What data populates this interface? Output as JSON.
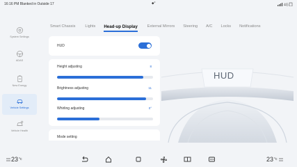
{
  "status": {
    "left": "16:16 PM Blanked in Outside 17",
    "center": "⬥°",
    "right": "Signal 4G"
  },
  "sidebar": {
    "items": [
      {
        "label": "System Settings",
        "icon": "settings-gear-icon"
      },
      {
        "label": "ADAS",
        "icon": "adas-steering-icon"
      },
      {
        "label": "New Energy",
        "icon": "battery-icon"
      },
      {
        "label": "Vehicle Settings",
        "icon": "car-icon",
        "active": true
      },
      {
        "label": "Vehicle Health",
        "icon": "car-health-icon"
      }
    ]
  },
  "tabs": [
    {
      "label": "Smart Chassis"
    },
    {
      "label": "Lights"
    },
    {
      "label": "Head-up Display",
      "active": true
    },
    {
      "label": "External Mirrors"
    },
    {
      "label": "Steering"
    },
    {
      "label": "A/C"
    },
    {
      "label": "Locks"
    },
    {
      "label": "Notifications"
    }
  ],
  "hud": {
    "toggle_label": "HUD",
    "enabled": true,
    "height": {
      "label": "Height adjusting",
      "value": "8",
      "level": 0.9
    },
    "brightness": {
      "label": "Brightness adjusting",
      "value": "11",
      "level": 0.93
    },
    "tilt": {
      "label": "Whirling adjusting",
      "value": "0°",
      "level": 0.44
    },
    "mode": {
      "label": "Mode setting"
    }
  },
  "preview": {
    "label": "HUD"
  },
  "bottom": {
    "temp_left": "23",
    "temp_right": "23",
    "unit": "°c"
  },
  "colors": {
    "accent": "#2b6fd8",
    "background": "#f2f4f7"
  }
}
